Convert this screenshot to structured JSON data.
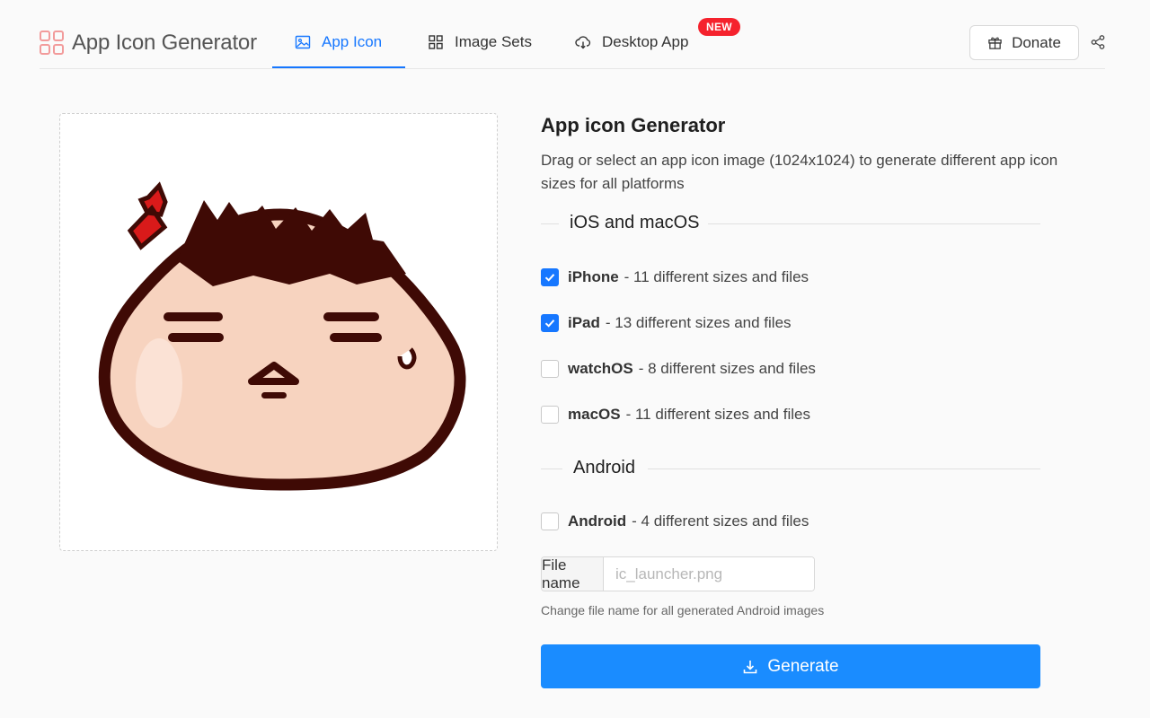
{
  "header": {
    "app_name": "App Icon Generator",
    "tabs": [
      {
        "label": "App Icon",
        "icon": "image-icon",
        "active": true
      },
      {
        "label": "Image Sets",
        "icon": "grid-icon",
        "active": false
      },
      {
        "label": "Desktop App",
        "icon": "cloud-download-icon",
        "active": false,
        "badge": "NEW"
      }
    ],
    "donate_label": "Donate"
  },
  "main": {
    "title": "App icon Generator",
    "description": "Drag or select an app icon image (1024x1024) to generate different app icon sizes for all platforms",
    "sections": [
      {
        "label": "iOS and macOS",
        "options": [
          {
            "name": "iPhone",
            "detail": "- 11 different sizes and files",
            "checked": true
          },
          {
            "name": "iPad",
            "detail": "- 13 different sizes and files",
            "checked": true
          },
          {
            "name": "watchOS",
            "detail": "- 8 different sizes and files",
            "checked": false
          },
          {
            "name": "macOS",
            "detail": "- 11 different sizes and files",
            "checked": false
          }
        ]
      },
      {
        "label": "Android",
        "options": [
          {
            "name": "Android",
            "detail": "- 4 different sizes and files",
            "checked": false
          }
        ]
      }
    ],
    "file_name": {
      "label": "File name",
      "placeholder": "ic_launcher.png",
      "hint": "Change file name for all generated Android images"
    },
    "generate_label": "Generate"
  },
  "colors": {
    "accent": "#1677ff",
    "button": "#1a8cff",
    "badge": "#f5222d"
  }
}
